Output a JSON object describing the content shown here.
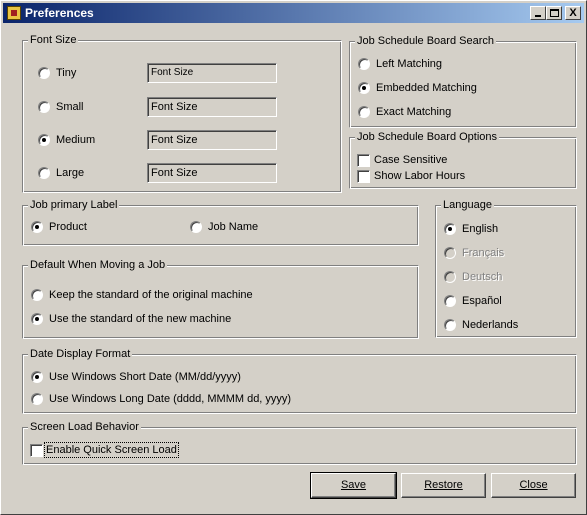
{
  "window": {
    "title": "Preferences",
    "controls": {
      "minimize": "_",
      "maximize": "□",
      "close": "X"
    }
  },
  "font_size": {
    "title": "Font Size",
    "options": [
      {
        "label": "Tiny",
        "selected": false,
        "sample": "Font Size"
      },
      {
        "label": "Small",
        "selected": false,
        "sample": "Font Size"
      },
      {
        "label": "Medium",
        "selected": true,
        "sample": "Font Size"
      },
      {
        "label": "Large",
        "selected": false,
        "sample": "Font Size"
      }
    ]
  },
  "search": {
    "title": "Job Schedule Board Search",
    "options": [
      {
        "label": "Left Matching",
        "selected": false
      },
      {
        "label": "Embedded Matching",
        "selected": true
      },
      {
        "label": "Exact Matching",
        "selected": false
      }
    ]
  },
  "board_options": {
    "title": "Job Schedule Board Options",
    "options": [
      {
        "label": "Case Sensitive",
        "checked": false
      },
      {
        "label": "Show Labor Hours",
        "checked": false
      }
    ]
  },
  "job_label": {
    "title": "Job primary Label",
    "options": [
      {
        "label": "Product",
        "selected": true
      },
      {
        "label": "Job Name",
        "selected": false
      }
    ]
  },
  "moving": {
    "title": "Default When Moving a Job",
    "options": [
      {
        "label": "Keep the standard of the original machine",
        "selected": false
      },
      {
        "label": "Use the standard of the new machine",
        "selected": true
      }
    ]
  },
  "language": {
    "title": "Language",
    "options": [
      {
        "label": "English",
        "selected": true,
        "enabled": true
      },
      {
        "label": "Français",
        "selected": false,
        "enabled": false
      },
      {
        "label": "Deutsch",
        "selected": false,
        "enabled": false
      },
      {
        "label": "Español",
        "selected": false,
        "enabled": true
      },
      {
        "label": "Nederlands",
        "selected": false,
        "enabled": true
      }
    ]
  },
  "date_format": {
    "title": "Date Display Format",
    "options": [
      {
        "label": "Use Windows Short Date  (MM/dd/yyyy)",
        "selected": true
      },
      {
        "label": "Use Windows Long Date  (dddd, MMMM dd, yyyy)",
        "selected": false
      }
    ]
  },
  "screen_load": {
    "title": "Screen Load Behavior",
    "option": {
      "label": "Enable Quick Screen Load",
      "checked": false
    }
  },
  "buttons": {
    "save": "Save",
    "restore": "Restore",
    "close": "Close"
  }
}
